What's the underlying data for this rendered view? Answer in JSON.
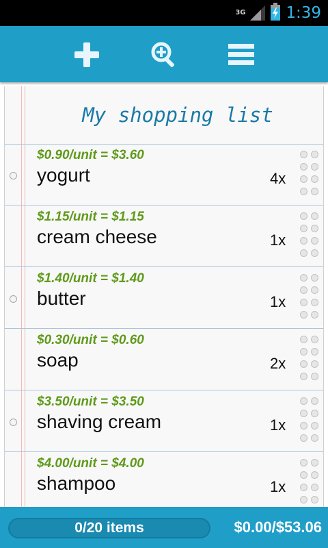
{
  "status_bar": {
    "network": "3G",
    "time": "1:39",
    "icons": [
      "signal-icon",
      "battery-charging-icon"
    ],
    "clock_color": "#33b5e5"
  },
  "action_bar": {
    "color": "#1f9ec8",
    "buttons": [
      {
        "icon": "add-icon"
      },
      {
        "icon": "zoom-in-icon"
      },
      {
        "icon": "menu-icon"
      }
    ]
  },
  "list": {
    "title": "My shopping list",
    "items": [
      {
        "price": "$0.90/unit = $3.60",
        "name": "yogurt",
        "qty": "4x",
        "has_radio": true
      },
      {
        "price": "$1.15/unit = $1.15",
        "name": "cream cheese",
        "qty": "1x",
        "has_radio": false
      },
      {
        "price": "$1.40/unit = $1.40",
        "name": "butter",
        "qty": "1x",
        "has_radio": true
      },
      {
        "price": "$0.30/unit = $0.60",
        "name": "soap",
        "qty": "2x",
        "has_radio": false
      },
      {
        "price": "$3.50/unit = $3.50",
        "name": "shaving cream",
        "qty": "1x",
        "has_radio": true
      },
      {
        "price": "$4.00/unit = $4.00",
        "name": "shampoo",
        "qty": "1x",
        "has_radio": false
      }
    ]
  },
  "footer": {
    "progress_label": "0/20 items",
    "progress_fraction": 0,
    "total": "$0.00/$53.06"
  }
}
